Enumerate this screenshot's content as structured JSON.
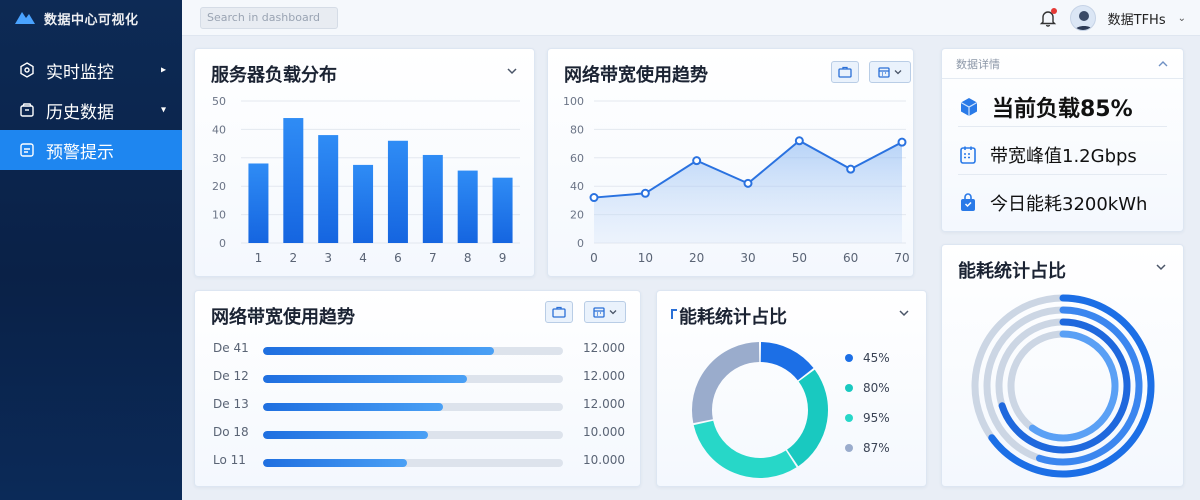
{
  "brand": {
    "name": "数据中心可视化"
  },
  "search": {
    "placeholder": "Search in dashboard"
  },
  "user": {
    "name": "数据TFHs"
  },
  "sidebar": {
    "items": [
      {
        "label": "实时监控",
        "icon": "monitor-icon",
        "active": false
      },
      {
        "label": "历史数据",
        "icon": "archive-icon",
        "active": false
      },
      {
        "label": "预警提示",
        "icon": "alert-list-icon",
        "active": true
      }
    ]
  },
  "colors": {
    "accent": "#1e86f0",
    "sidebar_bg": "#0d2a55",
    "bar_top": "#2f8cf5",
    "bar_bottom": "#1565e0",
    "teal": "#19c9c0",
    "gray": "#b7c4d6"
  },
  "server_load": {
    "title": "服务器负载分布",
    "chart_data": {
      "type": "bar",
      "categories": [
        "1",
        "2",
        "3",
        "4",
        "6",
        "7",
        "8",
        "9"
      ],
      "values": [
        28,
        44,
        38,
        27.5,
        36,
        31,
        25.5,
        23
      ],
      "ylim": [
        0,
        50
      ],
      "yticks": [
        "0",
        "10",
        "20",
        "30",
        "40",
        "50"
      ],
      "grid": true
    }
  },
  "bandwidth_trend": {
    "title": "网络带宽使用趋势",
    "chart_data": {
      "type": "area",
      "x": [
        0,
        10,
        20,
        30,
        40,
        50,
        60,
        70
      ],
      "xticks": [
        "0",
        "10",
        "20",
        "30",
        "50",
        "60",
        "70"
      ],
      "y": [
        32,
        35,
        58,
        42,
        72,
        52,
        71
      ],
      "ylim": [
        0,
        100
      ],
      "yticks": [
        "0",
        "20",
        "40",
        "60",
        "80",
        "100"
      ],
      "grid": true
    }
  },
  "bandwidth_bars": {
    "title": "网络带宽使用趋势",
    "rows": [
      {
        "label": "De 41",
        "fraction": 0.77,
        "value": "12.000"
      },
      {
        "label": "De 12",
        "fraction": 0.68,
        "value": "12.000"
      },
      {
        "label": "De 13",
        "fraction": 0.6,
        "value": "12.000"
      },
      {
        "label": "Do 18",
        "fraction": 0.55,
        "value": "10.000"
      },
      {
        "label": "Lo 11",
        "fraction": 0.48,
        "value": "10.000"
      }
    ]
  },
  "energy_donut": {
    "title": "能耗统计占比",
    "chart_data": {
      "type": "pie",
      "segments": [
        {
          "label": "45%",
          "value": 45,
          "color": "#1c6fe6"
        },
        {
          "label": "80%",
          "value": 80,
          "color": "#19c9c0"
        },
        {
          "label": "95%",
          "value": 95,
          "color": "#27d7c8"
        },
        {
          "label": "87%",
          "value": 87,
          "color": "#9aaccc"
        }
      ]
    }
  },
  "detail": {
    "title": "数据详情",
    "items": [
      {
        "text": "当前负载85%",
        "icon": "cube-icon"
      },
      {
        "text": "带宽峰值1.2Gbps",
        "icon": "calendar-icon"
      },
      {
        "text": "今日能耗3200kWh",
        "icon": "bag-icon"
      }
    ]
  },
  "energy_rings": {
    "title": "能耗统计占比",
    "rings": [
      {
        "value": 0.65,
        "color": "#1c6fe6"
      },
      {
        "value": 0.55,
        "color": "#3b86ef"
      },
      {
        "value": 0.7,
        "color": "#1f68dd"
      },
      {
        "value": 0.6,
        "color": "#5aa0f5"
      }
    ]
  }
}
